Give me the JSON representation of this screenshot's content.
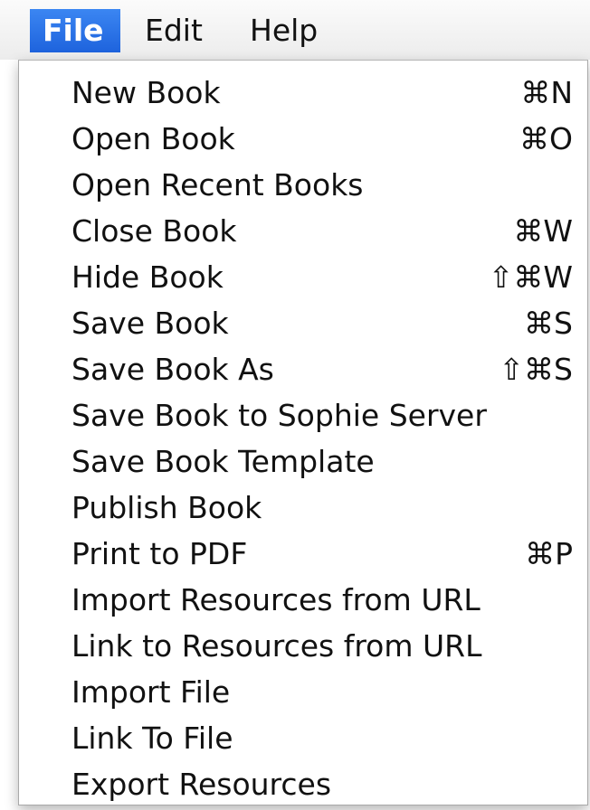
{
  "menubar": {
    "items": [
      {
        "label": "File",
        "active": true
      },
      {
        "label": "Edit",
        "active": false
      },
      {
        "label": "Help",
        "active": false
      }
    ]
  },
  "menu": {
    "items": [
      {
        "label": "New Book",
        "shortcut": "⌘N"
      },
      {
        "label": "Open Book",
        "shortcut": "⌘O"
      },
      {
        "label": "Open Recent Books",
        "shortcut": ""
      },
      {
        "label": "Close Book",
        "shortcut": "⌘W"
      },
      {
        "label": "Hide Book",
        "shortcut": "⇧⌘W"
      },
      {
        "label": "Save Book",
        "shortcut": "⌘S"
      },
      {
        "label": "Save Book As",
        "shortcut": "⇧⌘S"
      },
      {
        "label": "Save Book to Sophie Server",
        "shortcut": ""
      },
      {
        "label": "Save Book Template",
        "shortcut": ""
      },
      {
        "label": "Publish Book",
        "shortcut": ""
      },
      {
        "label": "Print to PDF",
        "shortcut": "⌘P"
      },
      {
        "label": "Import Resources from URL",
        "shortcut": ""
      },
      {
        "label": "Link to Resources from URL",
        "shortcut": ""
      },
      {
        "label": "Import File",
        "shortcut": ""
      },
      {
        "label": "Link To File",
        "shortcut": ""
      },
      {
        "label": "Export Resources",
        "shortcut": ""
      }
    ]
  },
  "colors": {
    "menubar_active": "#2a72e6",
    "menubar_active_text": "#ffffff",
    "text": "#111111"
  }
}
